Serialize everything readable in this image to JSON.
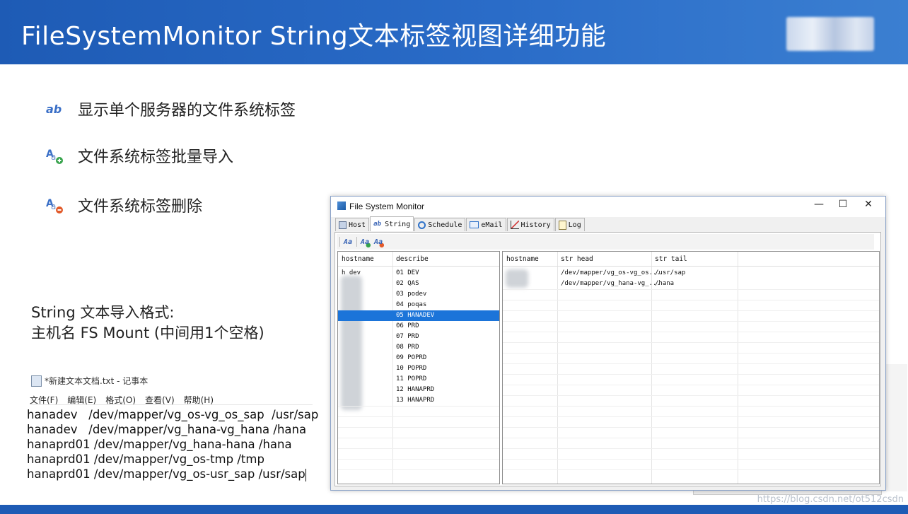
{
  "slide": {
    "title": "FileSystemMonitor   String文本标签视图详细功能",
    "bullets": [
      {
        "icon": "ab-string-icon",
        "text": "显示单个服务器的文件系统标签"
      },
      {
        "icon": "import-string-icon",
        "text": "文件系统标签批量导入"
      },
      {
        "icon": "delete-string-icon",
        "text": "文件系统标签删除"
      }
    ],
    "format_heading": "String 文本导入格式:",
    "format_desc": "主机名 FS Mount (中间用1个空格)",
    "watermark": "https://blog.csdn.net/ot512csdn"
  },
  "notepad": {
    "title": "*新建文本文档.txt - 记事本",
    "menu": [
      "文件(F)",
      "编辑(E)",
      "格式(O)",
      "查看(V)",
      "帮助(H)"
    ],
    "lines": [
      "hanadev   /dev/mapper/vg_os-vg_os_sap  /usr/sap",
      "hanadev   /dev/mapper/vg_hana-vg_hana /hana",
      "hanaprd01 /dev/mapper/vg_hana-hana /hana",
      "hanaprd01 /dev/mapper/vg_os-tmp /tmp",
      "hanaprd01 /dev/mapper/vg_os-usr_sap /usr/sap"
    ]
  },
  "app": {
    "window_title": "File System Monitor",
    "controls": {
      "minimize": "—",
      "maximize": "☐",
      "close": "✕"
    },
    "tabs": [
      {
        "label": "Host",
        "icon": "host-icon"
      },
      {
        "label": "String",
        "icon": "ab-string-icon",
        "active": true
      },
      {
        "label": "Schedule",
        "icon": "clock-icon"
      },
      {
        "label": "eMail",
        "icon": "email-icon"
      },
      {
        "label": "History",
        "icon": "chart-icon"
      },
      {
        "label": "Log",
        "icon": "log-icon"
      }
    ],
    "left_grid": {
      "columns": [
        "hostname",
        "describe"
      ],
      "rows": [
        {
          "hostname": "h  dev",
          "describe": "01 DEV"
        },
        {
          "hostname": "",
          "describe": "02 QAS"
        },
        {
          "hostname": "",
          "describe": "03 podev"
        },
        {
          "hostname": "",
          "describe": "04 poqas"
        },
        {
          "hostname": "",
          "describe": "05 HANADEV",
          "selected": true
        },
        {
          "hostname": "",
          "describe": "06 PRD"
        },
        {
          "hostname": "",
          "describe": "07 PRD"
        },
        {
          "hostname": "",
          "describe": "08 PRD"
        },
        {
          "hostname": "",
          "describe": "09 POPRD"
        },
        {
          "hostname": "",
          "describe": "10 POPRD"
        },
        {
          "hostname": "",
          "describe": "11 POPRD"
        },
        {
          "hostname": "",
          "describe": "12 HANAPRD"
        },
        {
          "hostname": "",
          "describe": "13 HANAPRD"
        }
      ]
    },
    "right_grid": {
      "columns": [
        "hostname",
        "str head",
        "str tail"
      ],
      "rows": [
        {
          "hostname": "",
          "str_head": "/dev/mapper/vg_os-vg_os...",
          "str_tail": "/usr/sap"
        },
        {
          "hostname": "",
          "str_head": "/dev/mapper/vg_hana-vg_...",
          "str_tail": "/hana"
        }
      ]
    }
  }
}
